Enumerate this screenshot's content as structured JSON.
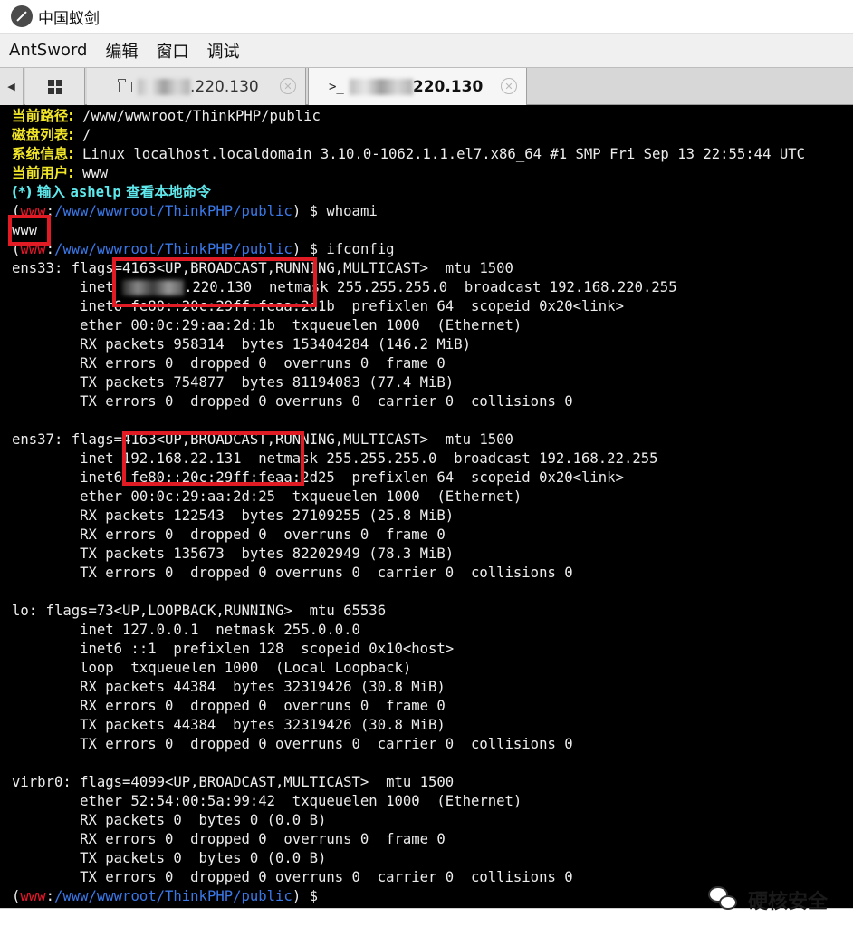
{
  "window": {
    "title": "中国蚁剑"
  },
  "menu": [
    "AntSword",
    "编辑",
    "窗口",
    "调试"
  ],
  "tabs": {
    "nav_arrow": "◀",
    "file_tab_label": ".220.130",
    "term_tab_prompt": ">_",
    "term_tab_label": "220.130",
    "close_glyph": "✕"
  },
  "terminal": {
    "path_label": "当前路径:",
    "path_value": " /www/wwwroot/ThinkPHP/public",
    "disk_label": "磁盘列表:",
    "disk_value": " /",
    "sys_label": "系统信息:",
    "sys_value": " Linux localhost.localdomain 3.10.0-1062.1.1.el7.x86_64 #1 SMP Fri Sep 13 22:55:44 UTC",
    "user_label": "当前用户:",
    "user_value": " www",
    "help_prefix": "(*) 输入 ",
    "help_cmd": "ashelp",
    "help_suffix": " 查看本地命令",
    "prompt_open": "(",
    "prompt_user": "www",
    "prompt_colon": ":",
    "prompt_path": "/www/wwwroot/ThinkPHP/public",
    "prompt_close": ") $ ",
    "cmd1": "whoami",
    "out_whoami": "www",
    "cmd2": "ifconfig",
    "ens33_l1": "ens33: flags=4163<UP,BROADCAST,RUNNING,MULTICAST>  mtu 1500",
    "ens33_l2_pre": "        inet ",
    "ens33_l2_post": ".220.130  netmask 255.255.255.0  broadcast 192.168.220.255",
    "ens33_l3": "        inet6 fe80::20c:29ff:feaa:2d1b  prefixlen 64  scopeid 0x20<link>",
    "ens33_l4": "        ether 00:0c:29:aa:2d:1b  txqueuelen 1000  (Ethernet)",
    "ens33_l5": "        RX packets 958314  bytes 153404284 (146.2 MiB)",
    "ens33_l6": "        RX errors 0  dropped 0  overruns 0  frame 0",
    "ens33_l7": "        TX packets 754877  bytes 81194083 (77.4 MiB)",
    "ens33_l8": "        TX errors 0  dropped 0 overruns 0  carrier 0  collisions 0",
    "ens37_l1": "ens37: flags=4163<UP,BROADCAST,RUNNING,MULTICAST>  mtu 1500",
    "ens37_l2": "        inet 192.168.22.131  netmask 255.255.255.0  broadcast 192.168.22.255",
    "ens37_l3": "        inet6 fe80::20c:29ff:feaa:2d25  prefixlen 64  scopeid 0x20<link>",
    "ens37_l4": "        ether 00:0c:29:aa:2d:25  txqueuelen 1000  (Ethernet)",
    "ens37_l5": "        RX packets 122543  bytes 27109255 (25.8 MiB)",
    "ens37_l6": "        RX errors 0  dropped 0  overruns 0  frame 0",
    "ens37_l7": "        TX packets 135673  bytes 82202949 (78.3 MiB)",
    "ens37_l8": "        TX errors 0  dropped 0 overruns 0  carrier 0  collisions 0",
    "lo_l1": "lo: flags=73<UP,LOOPBACK,RUNNING>  mtu 65536",
    "lo_l2": "        inet 127.0.0.1  netmask 255.0.0.0",
    "lo_l3": "        inet6 ::1  prefixlen 128  scopeid 0x10<host>",
    "lo_l4": "        loop  txqueuelen 1000  (Local Loopback)",
    "lo_l5": "        RX packets 44384  bytes 32319426 (30.8 MiB)",
    "lo_l6": "        RX errors 0  dropped 0  overruns 0  frame 0",
    "lo_l7": "        TX packets 44384  bytes 32319426 (30.8 MiB)",
    "lo_l8": "        TX errors 0  dropped 0 overruns 0  carrier 0  collisions 0",
    "vb_l1": "virbr0: flags=4099<UP,BROADCAST,MULTICAST>  mtu 1500",
    "vb_l2": "        ether 52:54:00:5a:99:42  txqueuelen 1000  (Ethernet)",
    "vb_l3": "        RX packets 0  bytes 0 (0.0 B)",
    "vb_l4": "        RX errors 0  dropped 0  overruns 0  frame 0",
    "vb_l5": "        TX packets 0  bytes 0 (0.0 B)",
    "vb_l6": "        TX errors 0  dropped 0 overruns 0  carrier 0  collisions 0"
  },
  "watermark": {
    "text": "硬核安全",
    "icon": "wechat-icon"
  },
  "colors": {
    "terminal_bg": "#000000",
    "label_yellow": "#f2e628",
    "accent_cyan": "#5fe8ec",
    "prompt_red": "#e8162a",
    "prompt_blue": "#3a78e8",
    "highlight_red": "#e01b24"
  }
}
